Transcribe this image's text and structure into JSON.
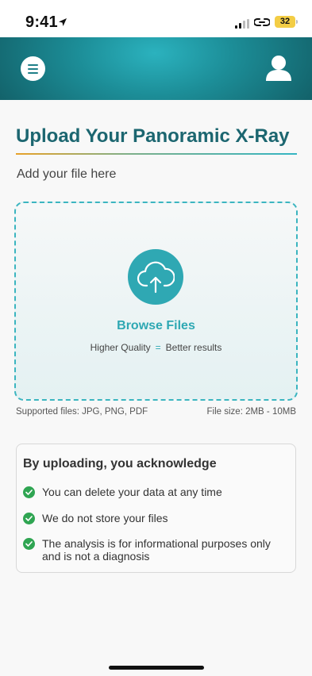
{
  "status_bar": {
    "time": "9:41",
    "battery": "32"
  },
  "header": {
    "menu_icon": "hamburger-menu-icon",
    "profile_icon": "user-profile-icon",
    "brand_color": "#1c8d97"
  },
  "main": {
    "title": "Upload Your Panoramic X-Ray",
    "subtitle": "Add your file here",
    "drop_zone": {
      "icon": "cloud-upload-icon",
      "browse_label": "Browse Files",
      "quality_left": "Higher Quality",
      "quality_eq": "=",
      "quality_right": "Better results"
    },
    "supported_files": "Supported files: JPG, PNG, PDF",
    "file_size": "File size: 2MB - 10MB"
  },
  "acknowledge": {
    "title": "By uploading, you acknowledge",
    "items": [
      {
        "text": "You can delete your data at any time"
      },
      {
        "text": "We do not store your files"
      },
      {
        "text": "The analysis is for informational purposes only and is not a diagnosis"
      }
    ],
    "check_color": "#2fa552"
  }
}
